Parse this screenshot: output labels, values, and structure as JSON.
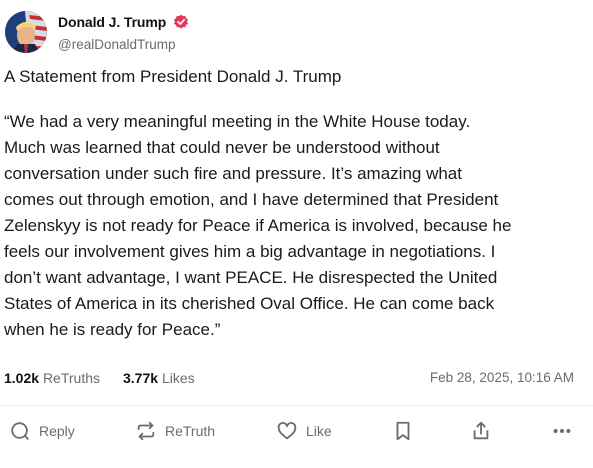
{
  "author": {
    "display_name": "Donald J. Trump",
    "handle": "@realDonaldTrump",
    "verified_icon": "verified-badge-icon",
    "verified_color": "#e5365c"
  },
  "post": {
    "title": "A Statement from President Donald J. Trump",
    "body": "“We had a very meaningful meeting in the White House today.\nMuch was learned that could never be understood without\nconversation under such fire and pressure. It’s amazing what\ncomes out through emotion, and I have determined that President\nZelenskyy is not ready for Peace if America is involved, because he\nfeels our involvement gives him a big advantage in negotiations. I\ndon’t want advantage, I want PEACE. He disrespected the United\nStates of America in its cherished Oval Office. He can come back\nwhen he is ready for Peace.”"
  },
  "stats": {
    "retruths_count": "1.02k",
    "retruths_label": "ReTruths",
    "likes_count": "3.77k",
    "likes_label": "Likes",
    "timestamp": "Feb 28, 2025, 10:16 AM"
  },
  "actions": {
    "reply_label": "Reply",
    "retruth_label": "ReTruth",
    "like_label": "Like"
  }
}
